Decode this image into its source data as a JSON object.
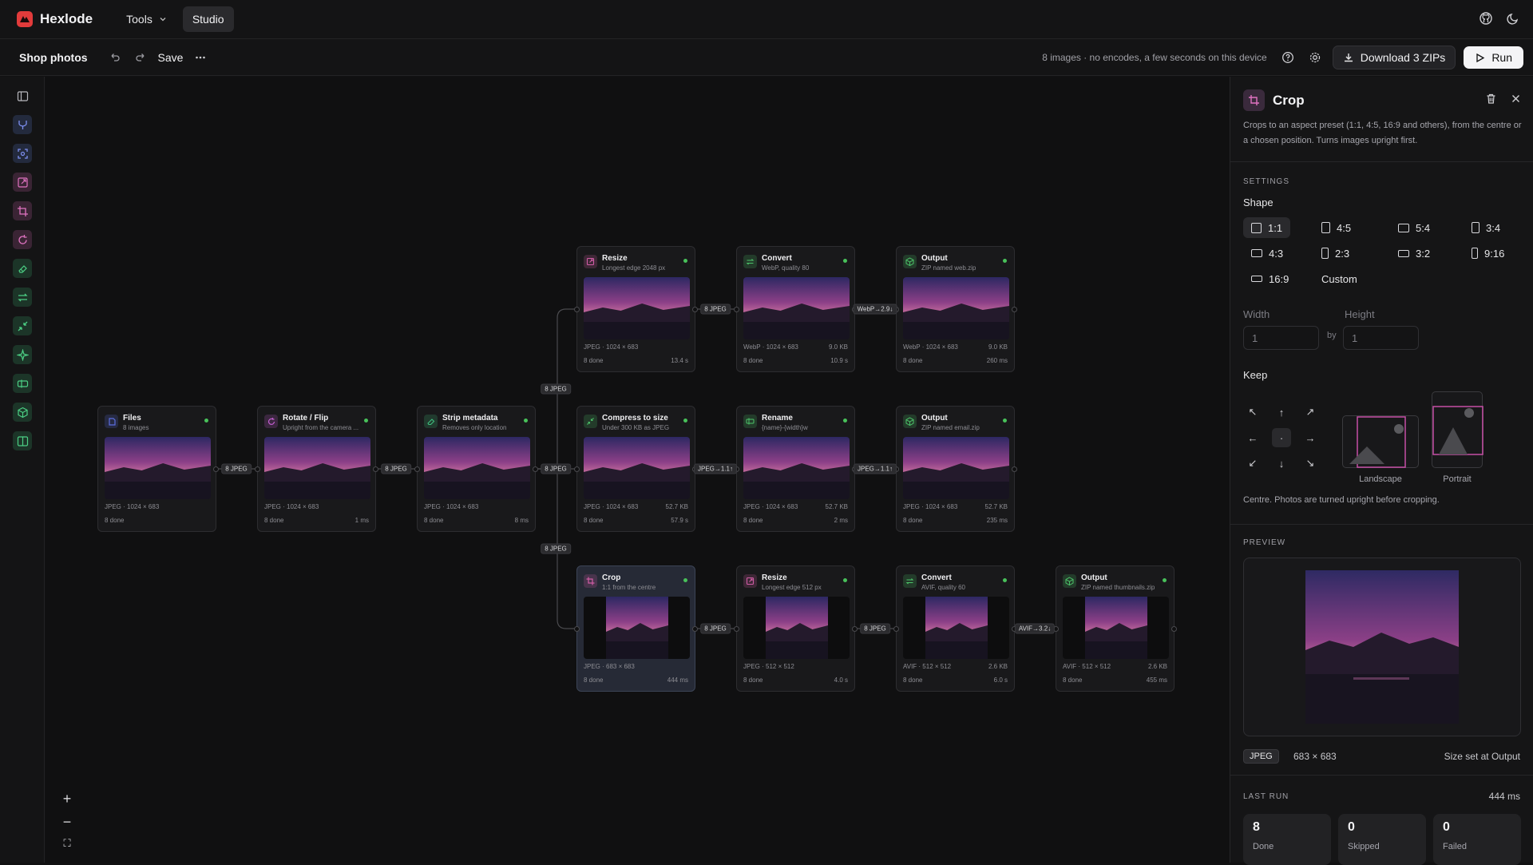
{
  "app": {
    "name": "Hexlode",
    "nav_tools": "Tools",
    "nav_studio": "Studio"
  },
  "toolbar": {
    "project": "Shop photos",
    "save_label": "Save",
    "status": "8 images · no encodes, a few seconds on this device",
    "download_label": "Download 3 ZIPs",
    "run_label": "Run"
  },
  "nodes": [
    {
      "id": "files",
      "title": "Files",
      "subtitle": "8 images",
      "meta": "JPEG · 1024 × 683",
      "size": "",
      "done": "8 done",
      "time": "",
      "icon": "files-icon",
      "color": "#5b6ee0"
    },
    {
      "id": "rotate",
      "title": "Rotate / Flip",
      "subtitle": "Upright from the camera ...",
      "meta": "JPEG · 1024 × 683",
      "size": "",
      "done": "8 done",
      "time": "1 ms",
      "icon": "rotate-icon",
      "color": "#c25dd0"
    },
    {
      "id": "strip",
      "title": "Strip metadata",
      "subtitle": "Removes only location",
      "meta": "JPEG · 1024 × 683",
      "size": "",
      "done": "8 done",
      "time": "8 ms",
      "icon": "eraser-icon",
      "color": "#3fc07f"
    },
    {
      "id": "resize1",
      "title": "Resize",
      "subtitle": "Longest edge 2048 px",
      "meta": "JPEG · 1024 × 683",
      "size": "",
      "done": "8 done",
      "time": "13.4 s",
      "icon": "resize-icon",
      "color": "#d05da6"
    },
    {
      "id": "convert1",
      "title": "Convert",
      "subtitle": "WebP, quality 80",
      "meta": "WebP · 1024 × 683",
      "size": "9.0 KB",
      "done": "8 done",
      "time": "10.9 s",
      "icon": "convert-icon",
      "color": "#4dc46a"
    },
    {
      "id": "output1",
      "title": "Output",
      "subtitle": "ZIP named web.zip",
      "meta": "WebP · 1024 × 683",
      "size": "9.0 KB",
      "done": "8 done",
      "time": "260 ms",
      "icon": "output-icon",
      "color": "#4dc46a"
    },
    {
      "id": "compress",
      "title": "Compress to size",
      "subtitle": "Under 300 KB as JPEG",
      "meta": "JPEG · 1024 × 683",
      "size": "52.7 KB",
      "done": "8 done",
      "time": "57.9 s",
      "icon": "compress-icon",
      "color": "#4dc46a"
    },
    {
      "id": "rename",
      "title": "Rename",
      "subtitle": "{name}-{width}w",
      "meta": "JPEG · 1024 × 683",
      "size": "52.7 KB",
      "done": "8 done",
      "time": "2 ms",
      "icon": "rename-icon",
      "color": "#4dc46a"
    },
    {
      "id": "output2",
      "title": "Output",
      "subtitle": "ZIP named email.zip",
      "meta": "JPEG · 1024 × 683",
      "size": "52.7 KB",
      "done": "8 done",
      "time": "235 ms",
      "icon": "output-icon",
      "color": "#4dc46a"
    },
    {
      "id": "crop",
      "title": "Crop",
      "subtitle": "1:1 from the centre",
      "meta": "JPEG · 683 × 683",
      "size": "",
      "done": "8 done",
      "time": "444 ms",
      "icon": "crop-icon",
      "color": "#d05da6",
      "selected": true
    },
    {
      "id": "resize2",
      "title": "Resize",
      "subtitle": "Longest edge 512 px",
      "meta": "JPEG · 512 × 512",
      "size": "",
      "done": "8 done",
      "time": "4.0 s",
      "icon": "resize-icon",
      "color": "#d05da6"
    },
    {
      "id": "convert2",
      "title": "Convert",
      "subtitle": "AVIF, quality 60",
      "meta": "AVIF · 512 × 512",
      "size": "2.6 KB",
      "done": "8 done",
      "time": "6.0 s",
      "icon": "convert-icon",
      "color": "#4dc46a"
    },
    {
      "id": "output3",
      "title": "Output",
      "subtitle": "ZIP named thumbnails.zip",
      "meta": "AVIF · 512 × 512",
      "size": "2.6 KB",
      "done": "8 done",
      "time": "455 ms",
      "icon": "output-icon",
      "color": "#4dc46a"
    }
  ],
  "edge_labels": [
    "8 JPEG",
    "8 JPEG",
    "8 JPEG",
    "8 JPEG",
    "8 JPEG",
    "8 JPEG",
    "WebP→2.9↓",
    "JPEG→1.1↑",
    "JPEG→1.1↑",
    "8 JPEG",
    "8 JPEG",
    "AVIF→3.2↓"
  ],
  "panel": {
    "title": "Crop",
    "description": "Crops to an aspect preset (1:1, 4:5, 16:9 and others), from the centre or a chosen position. Turns images upright first.",
    "settings_label": "SETTINGS",
    "shape_label": "Shape",
    "shapes": [
      "1:1",
      "4:5",
      "5:4",
      "3:4",
      "4:3",
      "2:3",
      "3:2",
      "9:16",
      "16:9",
      "Custom"
    ],
    "width_label": "Width",
    "height_label": "Height",
    "width_value": "1",
    "height_value": "1",
    "by_label": "by",
    "keep_label": "Keep",
    "landscape_label": "Landscape",
    "portrait_label": "Portrait",
    "note": "Centre. Photos are turned upright before cropping.",
    "preview_label": "PREVIEW",
    "format_pill": "JPEG",
    "dims": "683 × 683",
    "size_note": "Size set at Output",
    "last_run_label": "LAST RUN",
    "last_run_time": "444 ms",
    "stats": [
      {
        "num": "8",
        "cap": "Done"
      },
      {
        "num": "0",
        "cap": "Skipped"
      },
      {
        "num": "0",
        "cap": "Failed"
      }
    ]
  }
}
